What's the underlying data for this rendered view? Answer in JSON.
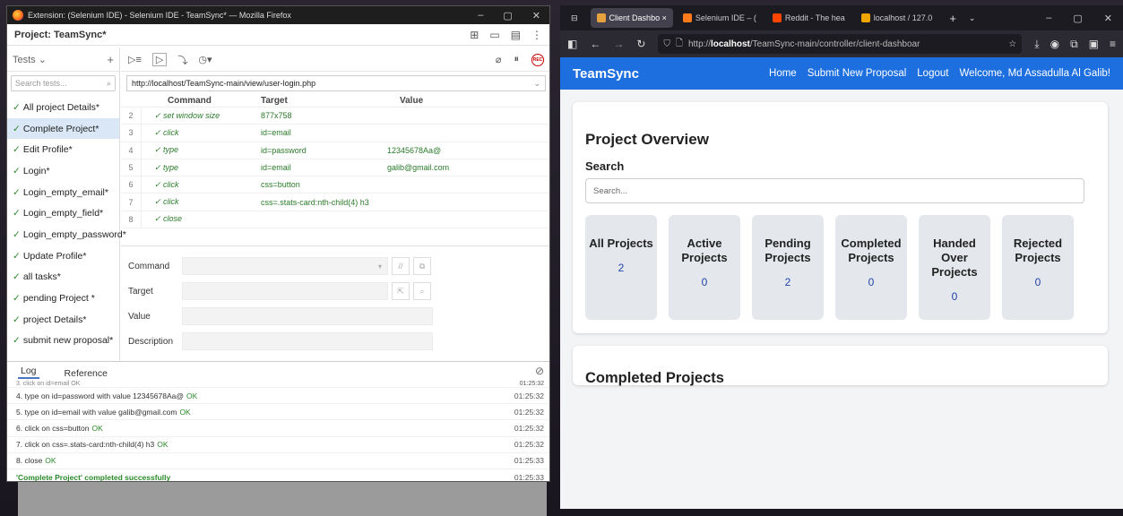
{
  "selenium": {
    "window_title": "Extension: (Selenium IDE) - Selenium IDE - TeamSync* — Mozilla Firefox",
    "project_label": "Project:  TeamSync*",
    "tests_label": "Tests",
    "search_placeholder": "Search tests...",
    "tests": [
      {
        "name": "All project Details*",
        "selected": false
      },
      {
        "name": "Complete Project*",
        "selected": true
      },
      {
        "name": "Edit Profile*",
        "selected": false
      },
      {
        "name": "Login*",
        "selected": false
      },
      {
        "name": "Login_empty_email*",
        "selected": false
      },
      {
        "name": "Login_empty_field*",
        "selected": false
      },
      {
        "name": "Login_empty_password*",
        "selected": false
      },
      {
        "name": "Update Profile*",
        "selected": false
      },
      {
        "name": "all tasks*",
        "selected": false
      },
      {
        "name": "pending Project *",
        "selected": false
      },
      {
        "name": "project Details*",
        "selected": false
      },
      {
        "name": "submit new proposal*",
        "selected": false
      }
    ],
    "base_url": "http://localhost/TeamSync-main/view/user-login.php",
    "columns": {
      "command": "Command",
      "target": "Target",
      "value": "Value"
    },
    "commands": [
      {
        "n": "2",
        "cmd": "✓ set window size",
        "target": "877x758",
        "value": ""
      },
      {
        "n": "3",
        "cmd": "✓ click",
        "target": "id=email",
        "value": ""
      },
      {
        "n": "4",
        "cmd": "✓ type",
        "target": "id=password",
        "value": "12345678Aa@"
      },
      {
        "n": "5",
        "cmd": "✓ type",
        "target": "id=email",
        "value": "galib@gmail.com"
      },
      {
        "n": "6",
        "cmd": "✓ click",
        "target": "css=button",
        "value": ""
      },
      {
        "n": "7",
        "cmd": "✓ click",
        "target": "css=.stats-card:nth-child(4) h3",
        "value": ""
      },
      {
        "n": "8",
        "cmd": "✓ close",
        "target": "",
        "value": ""
      }
    ],
    "editor": {
      "command": "Command",
      "target": "Target",
      "value": "Value",
      "description": "Description"
    },
    "log_tabs": {
      "log": "Log",
      "reference": "Reference"
    },
    "log_partial": {
      "text": "3.  click on id=email OK",
      "ts": "01:25:32"
    },
    "log_entries": [
      {
        "text": "4.  type on id=password with value 12345678Aa@",
        "ok": "OK",
        "ts": "01:25:32"
      },
      {
        "text": "5.  type on id=email with value galib@gmail.com",
        "ok": "OK",
        "ts": "01:25:32"
      },
      {
        "text": "6.  click on css=button",
        "ok": "OK",
        "ts": "01:25:32"
      },
      {
        "text": "7.  click on css=.stats-card:nth-child(4) h3",
        "ok": "OK",
        "ts": "01:25:32"
      },
      {
        "text": "8.  close",
        "ok": "OK",
        "ts": "01:25:33"
      }
    ],
    "log_success": {
      "text": "'Complete Project' completed successfully",
      "ts": "01:25:33"
    }
  },
  "firefox": {
    "tabs": [
      {
        "label": "Client Dashbo ×",
        "color": "#e6a23c",
        "active": true
      },
      {
        "label": "Selenium IDE – (",
        "color": "#ff7a1a",
        "active": false
      },
      {
        "label": "Reddit - The hea",
        "color": "#ff4500",
        "active": false
      },
      {
        "label": "localhost / 127.0",
        "color": "#f0a500",
        "active": false
      }
    ],
    "url_prefix": "http://",
    "url_host": "localhost",
    "url_path": "/TeamSync-main/controller/client-dashboar",
    "new_tab": "+"
  },
  "teamsync": {
    "brand": "TeamSync",
    "nav": [
      "Home",
      "Submit New Proposal",
      "Logout",
      "Welcome, Md Assadulla Al Galib!"
    ],
    "overview_title": "Project Overview",
    "search_label": "Search",
    "search_placeholder": "Search...",
    "stats": [
      {
        "label": "All Projects",
        "value": "2"
      },
      {
        "label": "Active Projects",
        "value": "0"
      },
      {
        "label": "Pending Projects",
        "value": "2"
      },
      {
        "label": "Completed Projects",
        "value": "0"
      },
      {
        "label": "Handed Over Projects",
        "value": "0"
      },
      {
        "label": "Rejected Projects",
        "value": "0"
      }
    ],
    "completed_title": "Completed Projects"
  }
}
